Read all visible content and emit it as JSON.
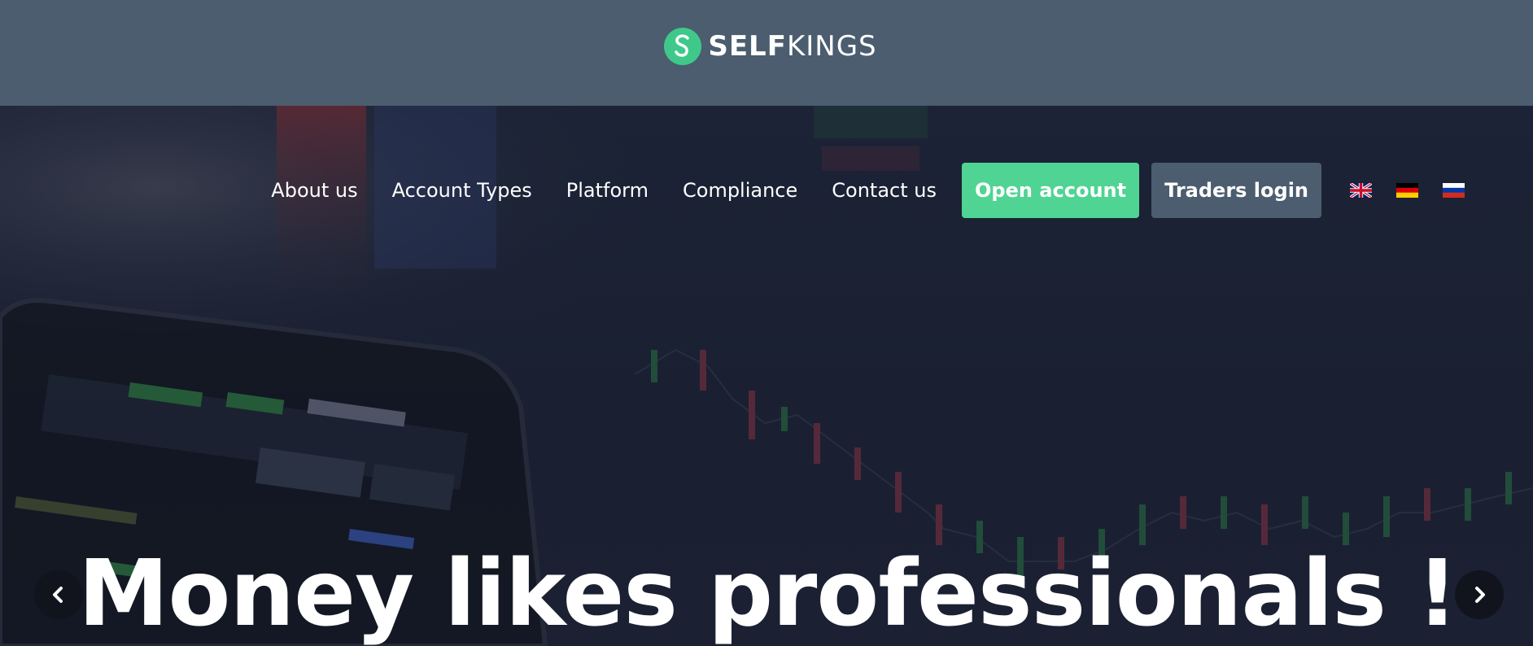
{
  "logo": {
    "bold": "SELF",
    "light": "KINGS",
    "mark": "S"
  },
  "nav": {
    "items": [
      {
        "label": "About us"
      },
      {
        "label": "Account Types"
      },
      {
        "label": "Platform"
      },
      {
        "label": "Compliance"
      },
      {
        "label": "Contact us"
      }
    ],
    "open_account": "Open account",
    "traders_login": "Traders login",
    "languages": [
      "uk-flag-icon",
      "germany-flag-icon",
      "russia-flag-icon"
    ]
  },
  "hero": {
    "headline": "Money likes professionals !",
    "prev_icon": "chevron-left-icon",
    "next_icon": "chevron-right-icon"
  },
  "colors": {
    "topbar": "#4b5d6e",
    "accent_green": "#4fd493",
    "login_button": "#4b5d6e",
    "hero_bg": "#1b2233"
  }
}
